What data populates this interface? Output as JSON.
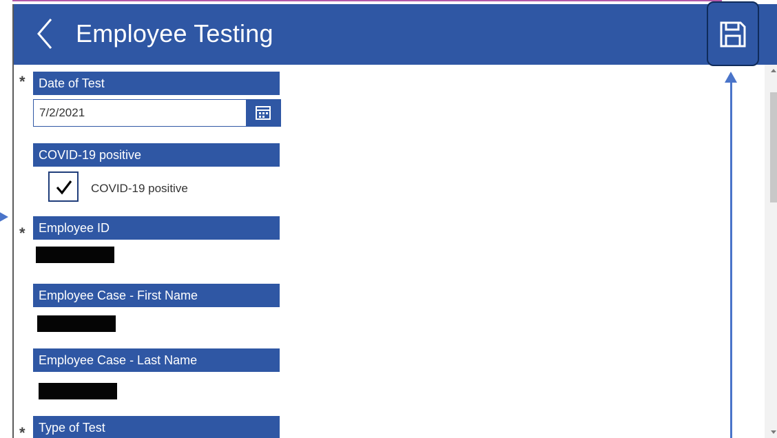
{
  "header": {
    "title": "Employee Testing",
    "back_icon": "chevron-left-icon",
    "save_icon": "save-icon"
  },
  "form": {
    "date_of_test": {
      "label": "Date of Test",
      "required": true,
      "value": "7/2/2021",
      "icon": "calendar-icon"
    },
    "covid_positive": {
      "label": "COVID-19 positive",
      "checkbox_label": "COVID-19 positive",
      "checked": true
    },
    "employee_id": {
      "label": "Employee ID",
      "required": true,
      "value_redacted": true
    },
    "first_name": {
      "label": "Employee Case - First Name",
      "value_redacted": true
    },
    "last_name": {
      "label": "Employee Case - Last Name",
      "value_redacted": true
    },
    "type_of_test": {
      "label": "Type of Test",
      "required": true
    },
    "required_marker": "*"
  },
  "colors": {
    "header": "#2f57a4",
    "label_bar": "#2f57a4",
    "annotation": "#4a74c9"
  }
}
